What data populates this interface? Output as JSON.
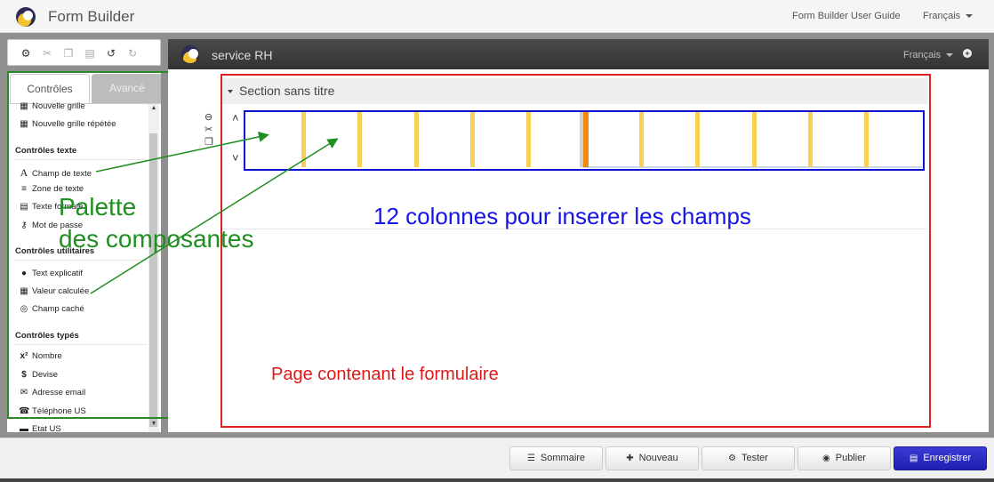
{
  "app": {
    "title": "Form Builder",
    "guide_link": "Form Builder User Guide",
    "language": "Français"
  },
  "toolbar": {
    "icons": [
      "settings-icon",
      "cut-icon",
      "copy-icon",
      "paste-icon",
      "undo-icon",
      "redo-icon"
    ]
  },
  "palette": {
    "tabs": [
      "Contrôles",
      "Avancé"
    ],
    "items_top": [
      {
        "label": "Nouvelle grille",
        "icon": "grid-icon"
      },
      {
        "label": "Nouvelle grille répétée",
        "icon": "repeated-grid-icon"
      }
    ],
    "group_text": {
      "title": "Contrôles texte",
      "items": [
        {
          "label": "Champ de texte",
          "icon": "text-field-icon"
        },
        {
          "label": "Zone de texte",
          "icon": "textarea-icon"
        },
        {
          "label": "Texte formaté",
          "icon": "formatted-text-icon"
        },
        {
          "label": "Mot de passe",
          "icon": "password-icon"
        }
      ]
    },
    "group_utility": {
      "title": "Contrôles utilitaires",
      "items": [
        {
          "label": "Text explicatif",
          "icon": "comment-icon"
        },
        {
          "label": "Valeur calculée",
          "icon": "calculator-icon"
        },
        {
          "label": "Champ caché",
          "icon": "hidden-eye-icon"
        }
      ]
    },
    "group_typed": {
      "title": "Contrôles typés",
      "items": [
        {
          "label": "Nombre",
          "icon": "number-icon"
        },
        {
          "label": "Devise",
          "icon": "dollar-icon"
        },
        {
          "label": "Adresse email",
          "icon": "envelope-icon"
        },
        {
          "label": "Téléphone US",
          "icon": "phone-icon"
        },
        {
          "label": "Etat US",
          "icon": "us-state-icon"
        }
      ]
    }
  },
  "form": {
    "name": "service RH",
    "language": "Français",
    "section_title": "Section sans titre",
    "grid_columns": 12
  },
  "annotations": {
    "palette": "Palette\ndes composantes",
    "palette_line1": "Palette",
    "palette_line2": "des composantes",
    "columns": "12 colonnes pour inserer les champs",
    "page": "Page contenant le formulaire"
  },
  "colors": {
    "palette_box": "#2a8a2a",
    "grid_box": "#1010d0",
    "page_box": "#e02020",
    "column_marker": "#f6d057",
    "column_marker_active": "#f28a10",
    "primary_button": "#2a2ac0"
  },
  "footer": {
    "buttons": [
      {
        "label": "Sommaire",
        "icon": "list-icon"
      },
      {
        "label": "Nouveau",
        "icon": "plus-icon"
      },
      {
        "label": "Tester",
        "icon": "gear-icon"
      },
      {
        "label": "Publier",
        "icon": "globe-icon"
      },
      {
        "label": "Enregistrer",
        "icon": "save-icon"
      }
    ]
  }
}
